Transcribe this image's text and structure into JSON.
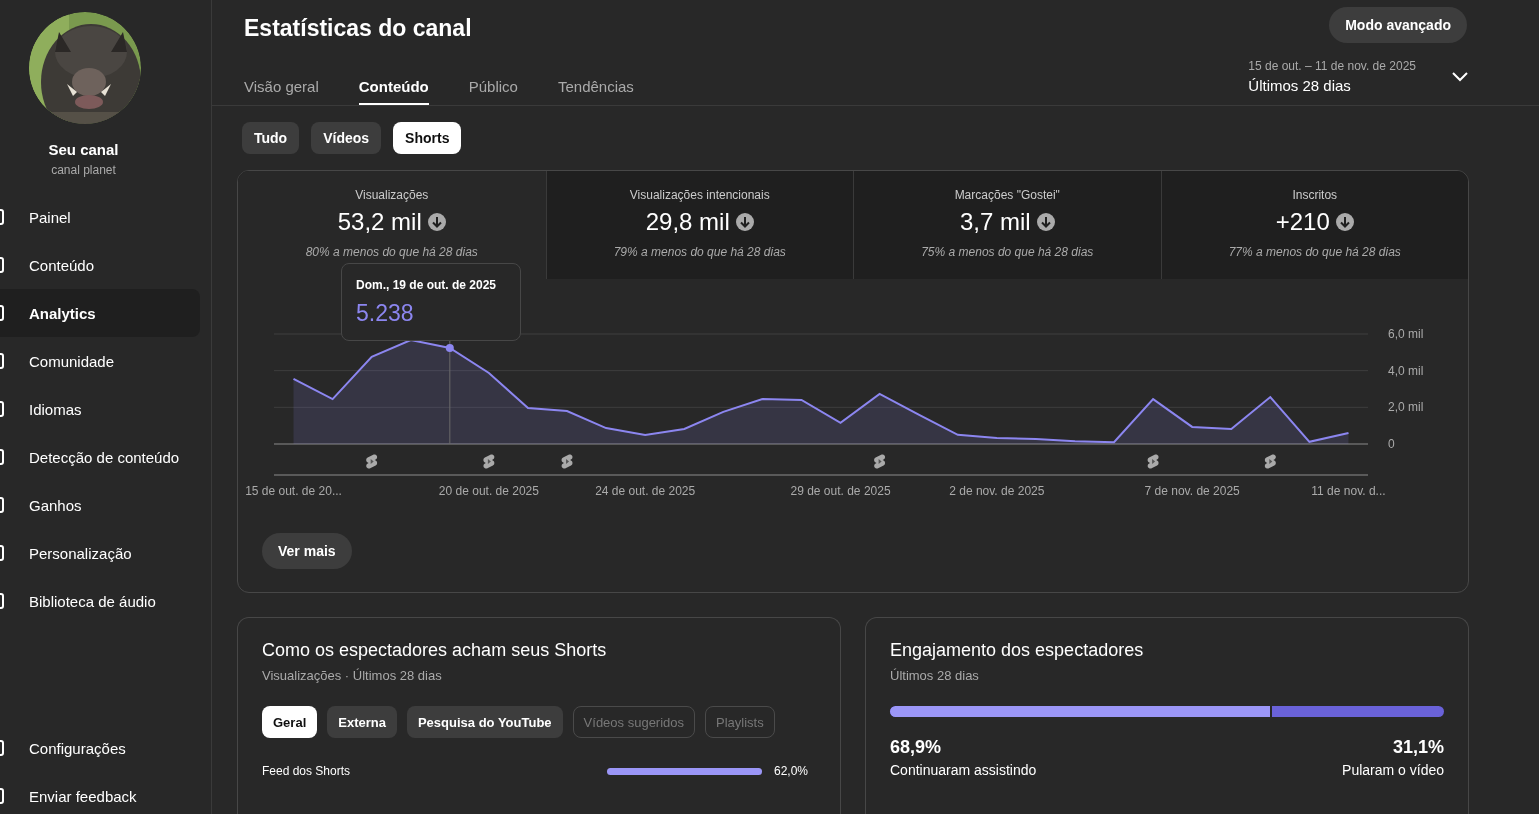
{
  "sidebar": {
    "channel_name": "Seu canal",
    "channel_handle": "canal planet",
    "items": [
      {
        "label": "Painel",
        "selected": false
      },
      {
        "label": "Conteúdo",
        "selected": false
      },
      {
        "label": "Analytics",
        "selected": true
      },
      {
        "label": "Comunidade",
        "selected": false
      },
      {
        "label": "Idiomas",
        "selected": false
      },
      {
        "label": "Detecção de conteúdo",
        "selected": false
      },
      {
        "label": "Ganhos",
        "selected": false
      },
      {
        "label": "Personalização",
        "selected": false
      },
      {
        "label": "Biblioteca de áudio",
        "selected": false
      }
    ],
    "bottom_items": [
      {
        "label": "Configurações",
        "selected": false
      },
      {
        "label": "Enviar feedback",
        "selected": false
      }
    ]
  },
  "header": {
    "title": "Estatísticas do canal",
    "advanced_button": "Modo avançado",
    "tabs": [
      {
        "label": "Visão geral",
        "selected": false
      },
      {
        "label": "Conteúdo",
        "selected": true
      },
      {
        "label": "Público",
        "selected": false
      },
      {
        "label": "Tendências",
        "selected": false
      }
    ],
    "date_range": {
      "range": "15 de out. – 11 de nov. de 2025",
      "label": "Últimos 28 dias"
    }
  },
  "filters": [
    {
      "label": "Tudo",
      "selected": false
    },
    {
      "label": "Vídeos",
      "selected": false
    },
    {
      "label": "Shorts",
      "selected": true
    }
  ],
  "overview": {
    "metrics": [
      {
        "label": "Visualizações",
        "value": "53,2 mil",
        "change": "80% a menos do que há 28 dias"
      },
      {
        "label": "Visualizações intencionais",
        "value": "29,8 mil",
        "change": "79% a menos do que há 28 dias"
      },
      {
        "label": "Marcações \"Gostei\"",
        "value": "3,7 mil",
        "change": "75% a menos do que há 28 dias"
      },
      {
        "label": "Inscritos",
        "value": "+210",
        "change": "77% a menos do que há 28 dias"
      }
    ],
    "chart_data": {
      "type": "area",
      "categories": [
        "15 de out. de 20...",
        null,
        null,
        null,
        null,
        "20 de out. de 2025",
        null,
        null,
        null,
        "24 de out. de 2025",
        null,
        null,
        null,
        null,
        "29 de out. de 2025",
        null,
        null,
        null,
        "2 de nov. de 2025",
        null,
        null,
        null,
        null,
        "7 de nov. de 2025",
        null,
        null,
        null,
        "11 de nov. d..."
      ],
      "series": [
        {
          "color": "#8c86f0",
          "values": [
            3.55,
            2.45,
            4.75,
            5.67,
            5.24,
            3.87,
            1.96,
            1.8,
            0.87,
            0.49,
            0.82,
            1.75,
            2.45,
            2.4,
            1.15,
            2.73,
            1.6,
            0.5,
            0.33,
            0.27,
            0.15,
            0.1,
            2.45,
            0.93,
            0.82,
            2.56,
            0.12,
            0.6
          ]
        }
      ],
      "ylim": [
        0,
        6
      ],
      "yticks": [
        {
          "value": 0,
          "label": "0"
        },
        {
          "value": 2,
          "label": "2,0 mil"
        },
        {
          "value": 4,
          "label": "4,0 mil"
        },
        {
          "value": 6,
          "label": "6,0 mil"
        }
      ]
    },
    "tooltip": {
      "date": "Dom., 19 de out. de 2025",
      "value": "5.238"
    },
    "more_button": "Ver mais"
  },
  "discovery": {
    "title": "Como os espectadores acham seus Shorts",
    "subtitle": "Visualizações · Últimos 28 dias",
    "chips": [
      {
        "label": "Geral",
        "selected": true,
        "disabled": false
      },
      {
        "label": "Externa",
        "selected": false,
        "disabled": false
      },
      {
        "label": "Pesquisa do YouTube",
        "selected": false,
        "disabled": false
      },
      {
        "label": "Vídeos sugeridos",
        "selected": false,
        "disabled": true
      },
      {
        "label": "Playlists",
        "selected": false,
        "disabled": true
      }
    ],
    "rows": [
      {
        "label": "Feed dos Shorts",
        "level": 1,
        "reading": "62,0%"
      }
    ]
  },
  "engagement": {
    "title": "Engajamento dos espectadores",
    "subtitle": "Últimos 28 dias",
    "bar": {
      "level": 0.689
    },
    "segments": [
      {
        "value": "68,9%",
        "label": "Continuaram assistindo"
      },
      {
        "value": "31,1%",
        "label": "Pularam o vídeo"
      }
    ]
  }
}
